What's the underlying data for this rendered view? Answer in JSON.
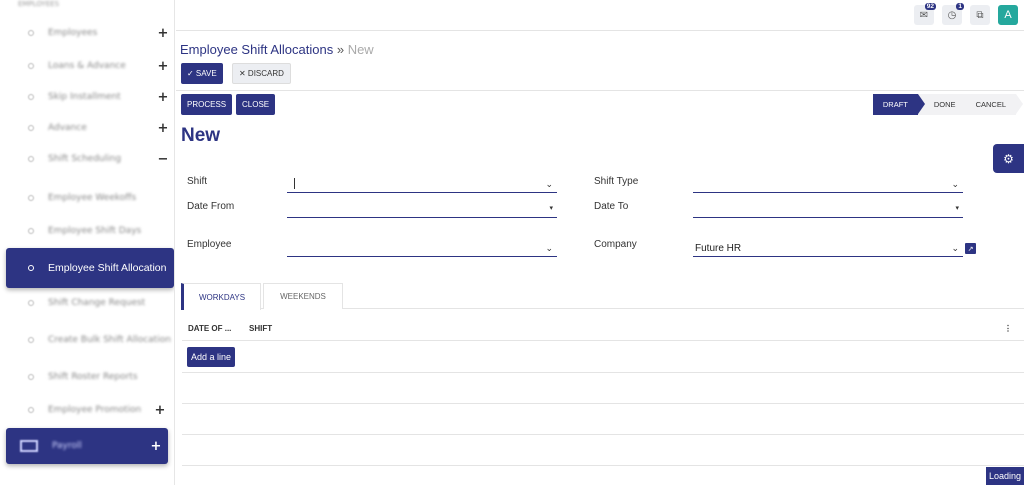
{
  "sidebar": {
    "header": "EMPLOYEES",
    "items": [
      {
        "label": "Employees",
        "sign": "+"
      },
      {
        "label": "Loans & Advance",
        "sign": "+"
      },
      {
        "label": "Skip Installment",
        "sign": "+"
      },
      {
        "label": "Advance",
        "sign": "+"
      },
      {
        "label": "Shift Scheduling",
        "sign": "−"
      },
      {
        "label": "Employee Weekoffs",
        "sign": ""
      },
      {
        "label": "Employee Shift Days",
        "sign": ""
      },
      {
        "label": "Employee Shift Allocation",
        "sign": ""
      },
      {
        "label": "Shift Change Request",
        "sign": ""
      },
      {
        "label": "Create Bulk Shift Allocation",
        "sign": ""
      },
      {
        "label": "Shift Roster Reports",
        "sign": ""
      },
      {
        "label": "Employee Promotion",
        "sign": "+"
      },
      {
        "label": "Payroll",
        "sign": "+"
      }
    ]
  },
  "topbar": {
    "messages_badge": "92",
    "activity_badge": "1",
    "avatar_letter": "A"
  },
  "breadcrumb": {
    "parent": "Employee Shift Allocations",
    "separator": "»",
    "current": "New"
  },
  "actions": {
    "save": "✓ SAVE",
    "discard": "✕ DISCARD",
    "process": "PROCESS",
    "close": "CLOSE"
  },
  "status": {
    "draft": "DRAFT",
    "done": "DONE",
    "cancel": "CANCEL"
  },
  "form": {
    "title": "New",
    "shift_label": "Shift",
    "shift_value": "",
    "shift_type_label": "Shift Type",
    "shift_type_value": "",
    "date_from_label": "Date From",
    "date_from_value": "",
    "date_to_label": "Date To",
    "date_to_value": "",
    "employee_label": "Employee",
    "employee_value": "",
    "company_label": "Company",
    "company_value": "Future HR"
  },
  "tabs": [
    "WORKDAYS",
    "WEEKENDS"
  ],
  "table": {
    "columns": [
      "DATE OF ...",
      "SHIFT"
    ],
    "add_line": "Add a line"
  },
  "loading": "Loading",
  "colors": {
    "primary": "#2d3483",
    "avatar": "#25a89d"
  }
}
